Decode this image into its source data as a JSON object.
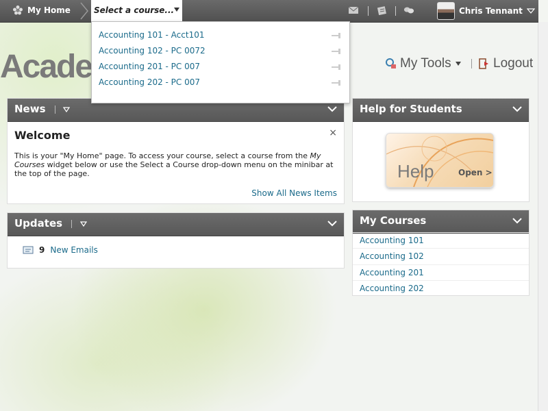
{
  "minibar": {
    "home_label": "My Home",
    "course_select_label": "Select a course...",
    "user_name": "Chris Tennant"
  },
  "course_dropdown": {
    "items": [
      "Accounting 101 - Acct101",
      "Accounting 102 - PC 0072",
      "Accounting 201 - PC 007",
      "Accounting 202 - PC 007"
    ]
  },
  "header": {
    "logo_text": "Acade",
    "tools_label": "My Tools",
    "logout_label": "Logout"
  },
  "news": {
    "title": "News",
    "welcome_title": "Welcome",
    "close_glyph": "×",
    "text_before": "This is your \"My Home\" page. To access your course, select a course from the ",
    "text_emph": "My Courses",
    "text_after": " widget below or use the Select a Course drop-down menu on the minibar at the top of the page.",
    "show_all": "Show All News Items"
  },
  "updates": {
    "title": "Updates",
    "count": "9",
    "label": "New Emails"
  },
  "help": {
    "title": "Help for Students",
    "banner_word": "Help",
    "banner_open": "Open >"
  },
  "my_courses": {
    "title": "My Courses",
    "items": [
      "Accounting 101",
      "Accounting 102",
      "Accounting 201",
      "Accounting 202"
    ]
  },
  "colors": {
    "link": "#1a6a8a",
    "header_bar": "#5a5a5a"
  }
}
